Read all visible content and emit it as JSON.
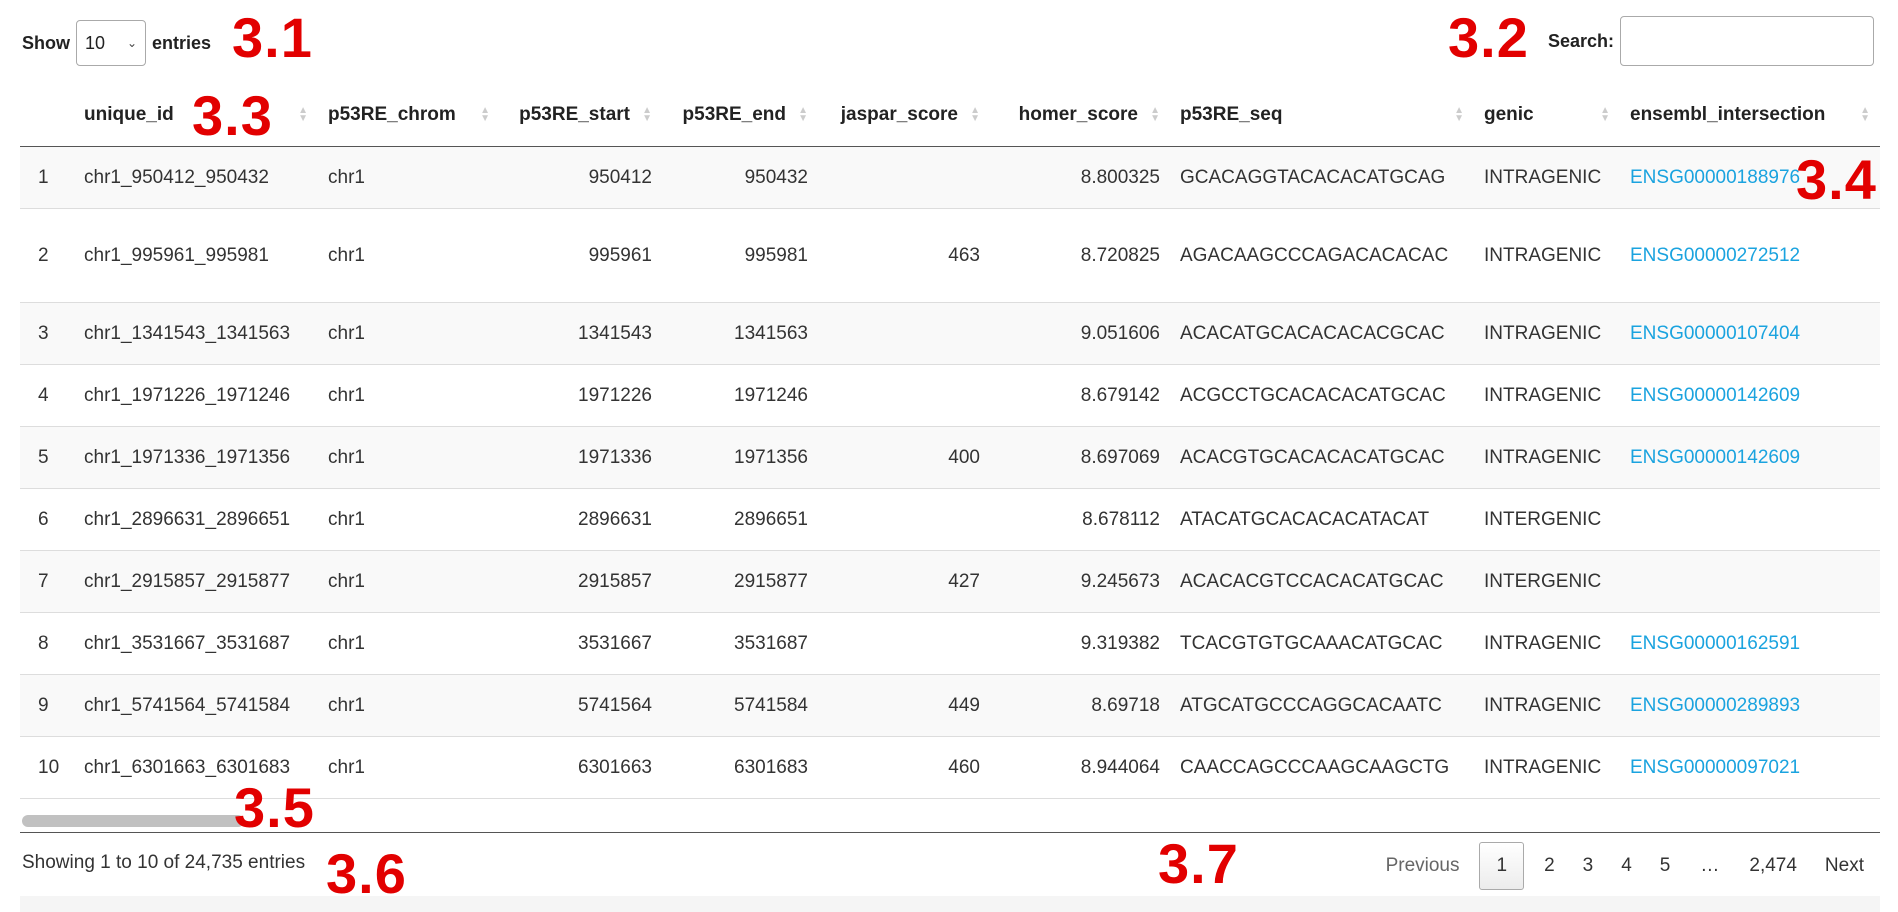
{
  "controls": {
    "show_label": "Show",
    "entries_label": "entries",
    "length_value": "10",
    "search_label": "Search:",
    "search_value": ""
  },
  "annotations": {
    "a31": "3.1",
    "a32": "3.2",
    "a33": "3.3",
    "a34": "3.4",
    "a35": "3.5",
    "a36": "3.6",
    "a37": "3.7"
  },
  "table": {
    "columns": [
      "",
      "unique_id",
      "p53RE_chrom",
      "p53RE_start",
      "p53RE_end",
      "jaspar_score",
      "homer_score",
      "p53RE_seq",
      "genic",
      "ensembl_intersection"
    ],
    "rows": [
      {
        "idx": "1",
        "unique_id": "chr1_950412_950432",
        "chrom": "chr1",
        "start": "950412",
        "end": "950432",
        "jaspar": "",
        "homer": "8.800325",
        "seq": "GCACAGGTACACACATGCAG",
        "genic": "INTRAGENIC",
        "ensembl": "ENSG00000188976"
      },
      {
        "idx": "2",
        "unique_id": "chr1_995961_995981",
        "chrom": "chr1",
        "start": "995961",
        "end": "995981",
        "jaspar": "463",
        "homer": "8.720825",
        "seq": "AGACAAGCCCAGACACACAC",
        "genic": "INTRAGENIC",
        "ensembl": "ENSG00000272512"
      },
      {
        "idx": "3",
        "unique_id": "chr1_1341543_1341563",
        "chrom": "chr1",
        "start": "1341543",
        "end": "1341563",
        "jaspar": "",
        "homer": "9.051606",
        "seq": "ACACATGCACACACACGCAC",
        "genic": "INTRAGENIC",
        "ensembl": "ENSG00000107404"
      },
      {
        "idx": "4",
        "unique_id": "chr1_1971226_1971246",
        "chrom": "chr1",
        "start": "1971226",
        "end": "1971246",
        "jaspar": "",
        "homer": "8.679142",
        "seq": "ACGCCTGCACACACATGCAC",
        "genic": "INTRAGENIC",
        "ensembl": "ENSG00000142609"
      },
      {
        "idx": "5",
        "unique_id": "chr1_1971336_1971356",
        "chrom": "chr1",
        "start": "1971336",
        "end": "1971356",
        "jaspar": "400",
        "homer": "8.697069",
        "seq": "ACACGTGCACACACATGCAC",
        "genic": "INTRAGENIC",
        "ensembl": "ENSG00000142609"
      },
      {
        "idx": "6",
        "unique_id": "chr1_2896631_2896651",
        "chrom": "chr1",
        "start": "2896631",
        "end": "2896651",
        "jaspar": "",
        "homer": "8.678112",
        "seq": "ATACATGCACACACATACAT",
        "genic": "INTERGENIC",
        "ensembl": ""
      },
      {
        "idx": "7",
        "unique_id": "chr1_2915857_2915877",
        "chrom": "chr1",
        "start": "2915857",
        "end": "2915877",
        "jaspar": "427",
        "homer": "9.245673",
        "seq": "ACACACGTCCACACATGCAC",
        "genic": "INTERGENIC",
        "ensembl": ""
      },
      {
        "idx": "8",
        "unique_id": "chr1_3531667_3531687",
        "chrom": "chr1",
        "start": "3531667",
        "end": "3531687",
        "jaspar": "",
        "homer": "9.319382",
        "seq": "TCACGTGTGCAAACATGCAC",
        "genic": "INTRAGENIC",
        "ensembl": "ENSG00000162591"
      },
      {
        "idx": "9",
        "unique_id": "chr1_5741564_5741584",
        "chrom": "chr1",
        "start": "5741564",
        "end": "5741584",
        "jaspar": "449",
        "homer": "8.69718",
        "seq": "ATGCATGCCCAGGCACAATC",
        "genic": "INTRAGENIC",
        "ensembl": "ENSG00000289893"
      },
      {
        "idx": "10",
        "unique_id": "chr1_6301663_6301683",
        "chrom": "chr1",
        "start": "6301663",
        "end": "6301683",
        "jaspar": "460",
        "homer": "8.944064",
        "seq": "CAACCAGCCCAAGCAAGCTG",
        "genic": "INTRAGENIC",
        "ensembl": "ENSG00000097021"
      }
    ]
  },
  "footer": {
    "info": "Showing 1 to 10 of 24,735 entries",
    "pagination": {
      "previous": "Previous",
      "pages": [
        "1",
        "2",
        "3",
        "4",
        "5",
        "…",
        "2,474"
      ],
      "next": "Next",
      "current": "1"
    }
  },
  "colors": {
    "link": "#1aa3df",
    "annotation": "#e20000",
    "stripe": "#f9f9f9"
  }
}
